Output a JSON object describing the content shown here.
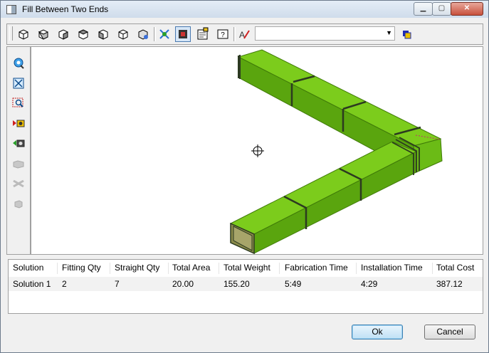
{
  "window": {
    "title": "Fill Between Two Ends"
  },
  "caption_buttons": {
    "minimize": "▁",
    "maximize": "▢",
    "close": "✕"
  },
  "toolbar": {
    "icons": [
      "view-iso-1-icon",
      "view-iso-2-icon",
      "view-iso-3-icon",
      "view-iso-4-icon",
      "view-iso-5-icon",
      "view-iso-6-icon",
      "view-iso-7-icon",
      "scale-icon",
      "shade-mode-icon",
      "properties-icon",
      "help-icon",
      "text-style-icon"
    ],
    "combo_value": ""
  },
  "leftbar": {
    "icons": [
      "zoom-icon",
      "zoom-extents-icon",
      "zoom-window-icon",
      "next-solution-icon",
      "prev-solution-icon",
      "disabled-tool-1-icon",
      "disabled-tool-2-icon",
      "disabled-tool-3-icon"
    ]
  },
  "colors": {
    "duct_top": "#7ccc1c",
    "duct_side": "#5aa50e",
    "duct_dark": "#3f7a08",
    "flange": "#2c3a20"
  },
  "grid": {
    "columns": [
      "Solution",
      "Fitting Qty",
      "Straight Qty",
      "Total Area",
      "Total Weight",
      "Fabrication Time",
      "Installation Time",
      "Total Cost"
    ],
    "rows": [
      [
        "Solution 1",
        "2",
        "7",
        "20.00",
        "155.20",
        "5:49",
        "4:29",
        "387.12"
      ]
    ]
  },
  "buttons": {
    "ok": "Ok",
    "cancel": "Cancel"
  }
}
